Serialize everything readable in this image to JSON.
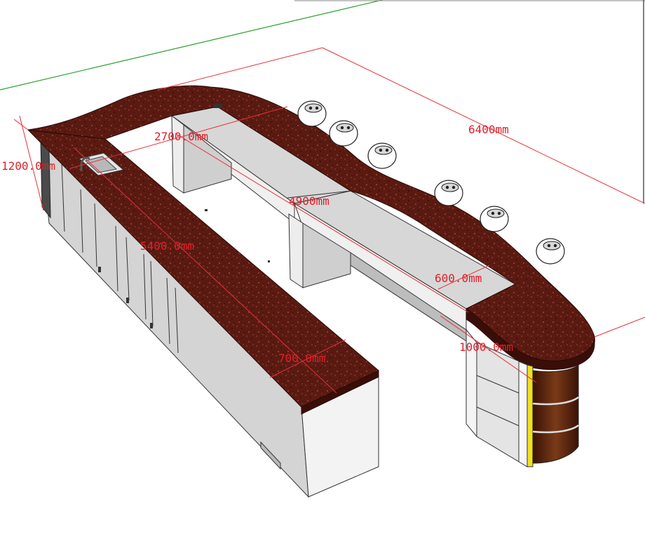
{
  "canvas": {
    "background": "#ffffff"
  },
  "colors": {
    "countertop": "#5a1a12",
    "countertop_speckle": "#8a3a2a",
    "cabinet_front": "#d6d6d6",
    "cabinet_side": "#f2f2f2",
    "dimension": "#e0202a",
    "axis_green": "#2aa02a",
    "axis_red": "#d03030",
    "accent_yellow": "#f0e020",
    "wood_column": "#6a2c12"
  },
  "dimensions": {
    "overall_length": "6400mm",
    "inner_length": "4900mm",
    "back_span": "2700.0mm",
    "end_depth": "1200.0mm",
    "left_run": "5400.0mm",
    "counter_depth_left": "700.0mm",
    "counter_depth_right": "600.0mm",
    "return_width": "1000.0mm"
  },
  "objects": {
    "stools": 6,
    "sink": "sink-icon",
    "tap": "faucet-icon"
  }
}
